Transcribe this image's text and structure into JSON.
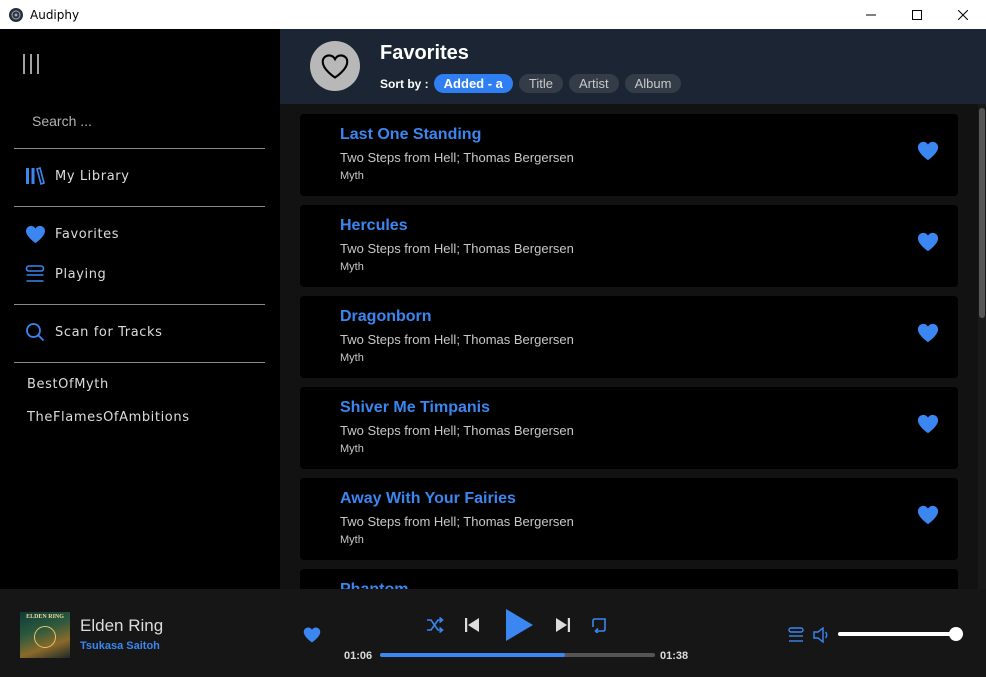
{
  "window": {
    "title": "Audiphy"
  },
  "sidebar": {
    "search_placeholder": "Search ...",
    "library_label": "My Library",
    "favorites_label": "Favorites",
    "playing_label": "Playing",
    "scan_label": "Scan for Tracks",
    "playlists": [
      "BestOfMyth",
      "TheFlamesOfAmbitions"
    ]
  },
  "main": {
    "title": "Favorites",
    "sort_label": "Sort by :",
    "sort_options": [
      "Added - a",
      "Title",
      "Artist",
      "Album"
    ],
    "active_sort": "Added - a",
    "tracks": [
      {
        "title": "Last One Standing",
        "artist": "Two Steps from Hell; Thomas Bergersen",
        "album": "Myth"
      },
      {
        "title": "Hercules",
        "artist": "Two Steps from Hell; Thomas Bergersen",
        "album": "Myth"
      },
      {
        "title": "Dragonborn",
        "artist": "Two Steps from Hell; Thomas Bergersen",
        "album": "Myth"
      },
      {
        "title": "Shiver Me Timpanis",
        "artist": "Two Steps from Hell; Thomas Bergersen",
        "album": "Myth"
      },
      {
        "title": "Away With Your Fairies",
        "artist": "Two Steps from Hell; Thomas Bergersen",
        "album": "Myth"
      },
      {
        "title": "Phantom",
        "artist": "",
        "album": ""
      }
    ]
  },
  "player": {
    "cover_text": "ELDEN RING",
    "title": "Elden Ring",
    "artist": "Tsukasa Saitoh",
    "elapsed": "01:06",
    "duration": "01:38",
    "progress": 0.673,
    "volume": 0.97
  },
  "colors": {
    "accent": "#3b86f0",
    "header_bg": "#1b2533",
    "card_bg": "#000000",
    "main_bg": "#121212"
  }
}
